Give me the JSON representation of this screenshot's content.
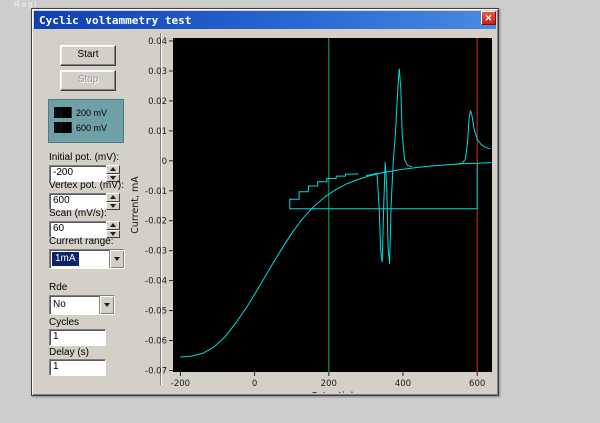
{
  "desktop": {
    "corner_text": "Regi"
  },
  "window": {
    "title": "Cyclic voltammetry test",
    "close_glyph": "✕"
  },
  "controls": {
    "start_label": "Start",
    "stop_label": "Stop",
    "legend": {
      "items": [
        {
          "label": "200 mV",
          "swatch_color": "#000000"
        },
        {
          "label": "600 mV",
          "swatch_color": "#000000"
        }
      ]
    },
    "fields": [
      {
        "label": "Initial pot. (mV):",
        "value": "-200",
        "type": "spin"
      },
      {
        "label": "Vertex pot. (mV):",
        "value": "600",
        "type": "spin"
      },
      {
        "label": "Scan (mV/s):",
        "value": "60",
        "type": "spin"
      },
      {
        "label": "Current range:",
        "value": "1mA",
        "type": "dropdown",
        "highlighted": true
      },
      {
        "label": "Rde",
        "value": "No",
        "type": "dropdown",
        "highlighted": false
      },
      {
        "label": "Cycles",
        "value": "1",
        "type": "text"
      },
      {
        "label": "Delay (s)",
        "value": "1",
        "type": "text"
      }
    ]
  },
  "chart_data": {
    "type": "line",
    "title": "",
    "xlabel": "Potential",
    "ylabel": "Current, mA",
    "xlim": [
      -220,
      640
    ],
    "ylim": [
      -0.0705,
      0.041
    ],
    "xticks": [
      -200,
      0,
      200,
      400,
      600
    ],
    "yticks": [
      0.04,
      0.03,
      0.02,
      0.01,
      0,
      -0.01,
      -0.02,
      -0.03,
      -0.04,
      -0.05,
      -0.06,
      -0.07
    ],
    "grid": false,
    "background": "#000000",
    "curve_color": "#00dcdc",
    "series": [
      {
        "name": "cv-sigmoid",
        "color": "#00dcdc",
        "points": [
          [
            -200,
            -0.0655
          ],
          [
            -170,
            -0.0652
          ],
          [
            -140,
            -0.0643
          ],
          [
            -110,
            -0.0622
          ],
          [
            -80,
            -0.0588
          ],
          [
            -50,
            -0.054
          ],
          [
            -20,
            -0.0486
          ],
          [
            10,
            -0.0425
          ],
          [
            40,
            -0.0362
          ],
          [
            70,
            -0.03
          ],
          [
            100,
            -0.0242
          ],
          [
            130,
            -0.0192
          ],
          [
            160,
            -0.0152
          ],
          [
            190,
            -0.012
          ],
          [
            220,
            -0.0095
          ],
          [
            250,
            -0.0076
          ],
          [
            280,
            -0.0062
          ],
          [
            310,
            -0.005
          ],
          [
            340,
            -0.0041
          ],
          [
            370,
            -0.0034
          ],
          [
            400,
            -0.0028
          ],
          [
            440,
            -0.0022
          ],
          [
            480,
            -0.0017
          ],
          [
            520,
            -0.0013
          ],
          [
            560,
            -0.001
          ],
          [
            600,
            -0.0008
          ],
          [
            638,
            -0.0006
          ]
        ]
      },
      {
        "name": "step-return",
        "color": "#00dcdc",
        "points": [
          [
            600,
            -0.001
          ],
          [
            600,
            -0.016
          ],
          [
            95,
            -0.016
          ],
          [
            95,
            -0.0128
          ],
          [
            120,
            -0.0128
          ],
          [
            120,
            -0.0103
          ],
          [
            145,
            -0.0103
          ],
          [
            145,
            -0.0084
          ],
          [
            170,
            -0.0084
          ],
          [
            170,
            -0.007
          ],
          [
            195,
            -0.007
          ],
          [
            195,
            -0.0059
          ],
          [
            220,
            -0.0059
          ],
          [
            220,
            -0.0051
          ],
          [
            245,
            -0.0051
          ],
          [
            245,
            -0.0045
          ],
          [
            280,
            -0.0044
          ]
        ]
      },
      {
        "name": "spikes",
        "color": "#00dcdc",
        "points": [
          [
            300,
            -0.005
          ],
          [
            330,
            -0.0042
          ],
          [
            336,
            -0.016
          ],
          [
            340,
            -0.03
          ],
          [
            344,
            -0.0338
          ],
          [
            348,
            -0.015
          ],
          [
            352,
            -0.0005
          ],
          [
            356,
            -0.008
          ],
          [
            360,
            -0.029
          ],
          [
            364,
            -0.0345
          ],
          [
            368,
            -0.015
          ],
          [
            374,
            0.0
          ],
          [
            380,
            0.01
          ],
          [
            386,
            0.024
          ],
          [
            390,
            0.0308
          ],
          [
            394,
            0.024
          ],
          [
            398,
            0.009
          ],
          [
            404,
            0.0005
          ],
          [
            412,
            -0.0015
          ],
          [
            424,
            -0.002
          ]
        ]
      },
      {
        "name": "right-peak",
        "color": "#00dcdc",
        "points": [
          [
            540,
            -0.0012
          ],
          [
            560,
            -0.0008
          ],
          [
            568,
            0.0005
          ],
          [
            574,
            0.006
          ],
          [
            578,
            0.014
          ],
          [
            582,
            0.0168
          ],
          [
            586,
            0.015
          ],
          [
            592,
            0.0105
          ],
          [
            600,
            0.0072
          ],
          [
            610,
            0.0055
          ],
          [
            622,
            0.0045
          ],
          [
            636,
            0.004
          ]
        ]
      }
    ],
    "markers": [
      {
        "name": "vline-200",
        "x": 200,
        "color": "#00b070"
      },
      {
        "name": "vline-600",
        "x": 600,
        "color": "#d03030"
      }
    ]
  }
}
